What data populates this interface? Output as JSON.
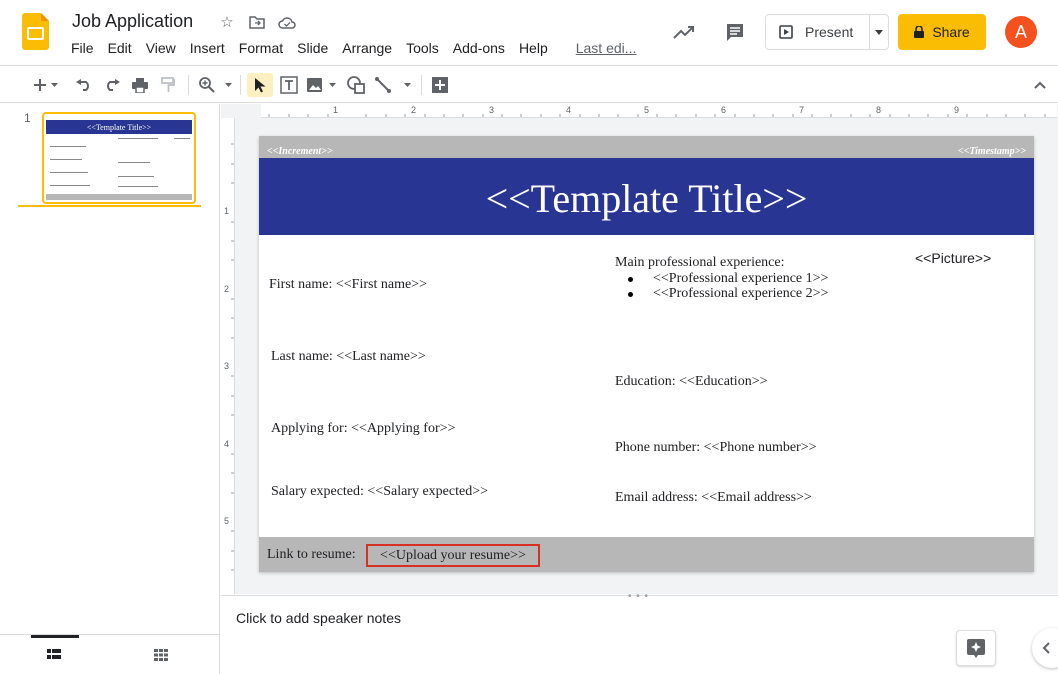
{
  "header": {
    "doc_title": "Job Application",
    "menu": [
      "File",
      "Edit",
      "View",
      "Insert",
      "Format",
      "Slide",
      "Arrange",
      "Tools",
      "Add-ons",
      "Help"
    ],
    "last_edit": "Last edi...",
    "present_label": "Present",
    "share_label": "Share",
    "avatar_letter": "A",
    "brand_yellow": "#fbbc04",
    "avatar_color": "#f4511e"
  },
  "filmstrip": {
    "slide_number": "1",
    "thumb_title": "<<Template Title>>"
  },
  "rulers": {
    "horizontal": [
      "1",
      "2",
      "3",
      "4",
      "5",
      "6",
      "7",
      "8",
      "9"
    ],
    "vertical": [
      "1",
      "2",
      "3",
      "4",
      "5"
    ]
  },
  "slide": {
    "increment": "<<Increment>>",
    "timestamp": "<<Timestamp>>",
    "title": "<<Template Title>>",
    "title_bar_color": "#283593",
    "first_name": "First name: <<First name>>",
    "last_name": "Last name: <<Last name>>",
    "applying_for": "Applying for: <<Applying for>>",
    "salary": "Salary expected: <<Salary expected>>",
    "main_experience": "Main professional experience:",
    "experiences": [
      "<<Professional experience 1>>",
      "<<Professional experience 2>>"
    ],
    "picture": "<<Picture>>",
    "education": "Education:  <<Education>>",
    "phone": "Phone number: <<Phone number>>",
    "email": "Email address: <<Email address>>",
    "link_label": "Link to resume:",
    "link_value": "<<Upload your resume>>",
    "highlight_color": "#d93025"
  },
  "notes": {
    "placeholder": "Click to add speaker notes"
  }
}
